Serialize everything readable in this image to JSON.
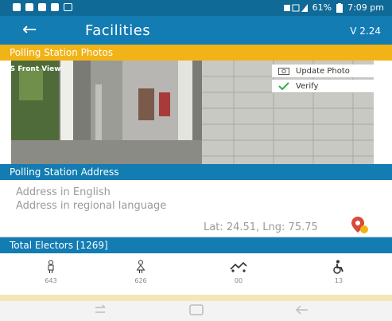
{
  "status": {
    "text": "61%",
    "time": "7:09 pm"
  },
  "toolbar": {
    "title": "Facilities",
    "version": "V 2.24"
  },
  "photos_section": {
    "title": "Polling Station Photos",
    "photo_label": "PS Front View",
    "update_label": "Update Photo",
    "verify_label": "Verify"
  },
  "address_section": {
    "title": "Polling Station Address",
    "address_english": "Address in English",
    "address_regional": "Address in regional language",
    "latlng": "Lat: 24.51, Lng: 75.75"
  },
  "electors": {
    "title": "Total Electors [1269]",
    "categories": [
      {
        "icon": "male-icon",
        "count": "643"
      },
      {
        "icon": "female-icon",
        "count": "626"
      },
      {
        "icon": "third-gender-icon",
        "count": "00"
      },
      {
        "icon": "wheelchair-icon",
        "count": "13"
      }
    ]
  },
  "colors": {
    "primary": "#137cb2",
    "statusbar": "#0f6a97",
    "accent": "#f2b317"
  }
}
